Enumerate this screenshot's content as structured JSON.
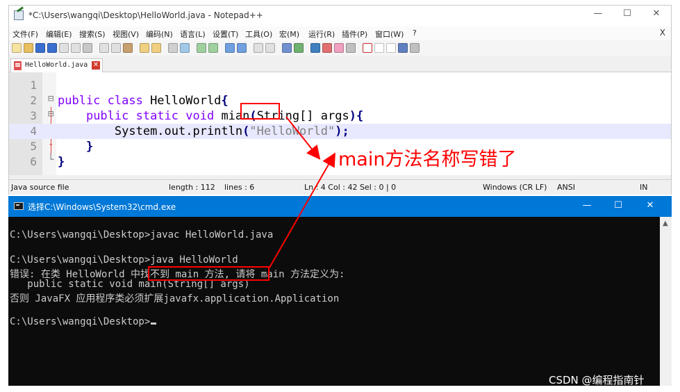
{
  "notepad": {
    "title": "*C:\\Users\\wangqi\\Desktop\\HelloWorld.java - Notepad++",
    "menu": [
      "文件(F)",
      "编辑(E)",
      "搜索(S)",
      "视图(V)",
      "编码(N)",
      "语言(L)",
      "设置(T)",
      "工具(O)",
      "宏(M)",
      "运行(R)",
      "插件(P)",
      "窗口(W)",
      "?"
    ],
    "close_glyph": "X",
    "tab_label": "HelloWorld.java",
    "line_numbers": [
      "1",
      "2",
      "3",
      "4",
      "5",
      "6"
    ],
    "code": {
      "l2_kw": "public class",
      "l2_name": " HelloWorld",
      "l2_brace": "{",
      "l3_kw": "public static void",
      "l3_sp": " ",
      "l3_method": "mian",
      "l3_paren": "(",
      "l3_type": "String",
      "l3_args": "[] args",
      "l3_close": "){",
      "l4_call": "System.out.println",
      "l4_open": "(",
      "l4_str": "\"HelloWorld\"",
      "l4_close": ");",
      "l5_brace": "}",
      "l6_brace": "}"
    },
    "status": {
      "file_type": "Java source file",
      "length": "length : 112",
      "lines": "lines : 6",
      "pos": "Ln : 4    Col : 42    Sel : 0 | 0",
      "eol": "Windows (CR LF)",
      "encoding": "ANSI",
      "mode": "IN"
    }
  },
  "cmd": {
    "title": "选择C:\\Windows\\System32\\cmd.exe",
    "lines": [
      "C:\\Users\\wangqi\\Desktop>javac HelloWorld.java",
      "C:\\Users\\wangqi\\Desktop>java HelloWorld",
      "错误: 在类 HelloWorld 中找不到 main 方法, 请将 main 方法定义为:",
      "   public static void main(String[] args)",
      "否则 JavaFX 应用程序类必须扩展javafx.application.Application",
      "C:\\Users\\wangqi\\Desktop>"
    ]
  },
  "annotation": "main方法名称写错了",
  "watermark": "CSDN @编程指南针",
  "colors": {
    "annotation": "#ff0000",
    "cmd_title": "#0078d7",
    "keyword": "#8000ff",
    "type": "#0000ff"
  }
}
